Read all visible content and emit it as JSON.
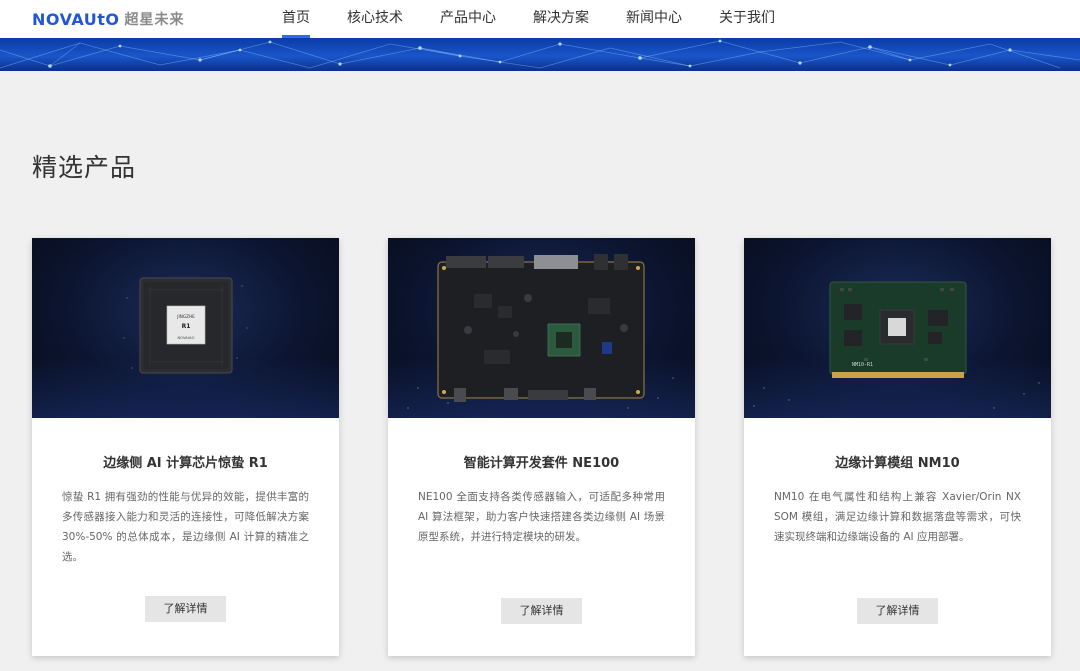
{
  "header": {
    "logo_en": "NOVAUtO",
    "logo_cn": "超星未来",
    "nav": [
      {
        "label": "首页",
        "active": true
      },
      {
        "label": "核心技术",
        "active": false
      },
      {
        "label": "产品中心",
        "active": false
      },
      {
        "label": "解决方案",
        "active": false
      },
      {
        "label": "新闻中心",
        "active": false
      },
      {
        "label": "关于我们",
        "active": false
      }
    ]
  },
  "section": {
    "title": "精选产品"
  },
  "products": [
    {
      "title": "边缘侧 AI 计算芯片惊蛰 R1",
      "description": "惊蛰 R1 拥有强劲的性能与优异的效能，提供丰富的多传感器接入能力和灵活的连接性，可降低解决方案 30%-50% 的总体成本，是边缘侧 AI 计算的精准之选。",
      "button": "了解详情",
      "chip_text": [
        "JINGZHE",
        "R1",
        "NOVAUtO"
      ]
    },
    {
      "title": "智能计算开发套件 NE100",
      "description": "NE100 全面支持各类传感器输入，可适配多种常用 AI 算法框架，助力客户快速搭建各类边缘侧 AI 场景原型系统，并进行特定模块的研发。",
      "button": "了解详情"
    },
    {
      "title": "边缘计算模组 NM10",
      "description": "NM10 在电气属性和结构上兼容 Xavier/Orin NX SOM 模组，满足边缘计算和数据落盘等需求，可快速实现终端和边缘端设备的 AI 应用部署。",
      "button": "了解详情",
      "module_text": "NM10-R1"
    }
  ],
  "colors": {
    "brand": "#2157d6",
    "nav_active": "#2a6ee8",
    "page_bg": "#f0f0f0"
  }
}
